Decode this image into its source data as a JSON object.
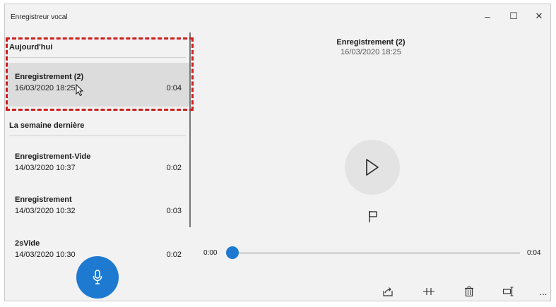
{
  "window": {
    "title": "Enregistreur vocal",
    "controls": {
      "minimize": "–",
      "maximize": "☐",
      "close": "✕"
    }
  },
  "sidebar": {
    "groups": [
      {
        "header": "Aujourd'hui",
        "items": [
          {
            "name": "Enregistrement (2)",
            "date": "16/03/2020 18:25",
            "duration": "0:04",
            "selected": true
          }
        ]
      },
      {
        "header": "La semaine dernière",
        "items": [
          {
            "name": "Enregistrement-Vide",
            "date": "14/03/2020 10:37",
            "duration": "0:02"
          },
          {
            "name": "Enregistrement",
            "date": "14/03/2020 10:32",
            "duration": "0:03"
          },
          {
            "name": "2sVide",
            "date": "14/03/2020 10:30",
            "duration": "0:02"
          }
        ]
      }
    ],
    "record_button": {
      "icon": "microphone-icon"
    }
  },
  "player": {
    "title": "Enregistrement (2)",
    "date": "16/03/2020 18:25",
    "time_start": "0:00",
    "time_end": "0:04",
    "progress": 0.0,
    "play_icon": "play-icon",
    "flag_icon": "flag-icon"
  },
  "toolbar": {
    "items": [
      {
        "id": "share",
        "icon": "share-icon"
      },
      {
        "id": "trim",
        "icon": "trim-icon"
      },
      {
        "id": "delete",
        "icon": "delete-icon"
      },
      {
        "id": "rename",
        "icon": "rename-icon"
      },
      {
        "id": "more",
        "icon": "more-icon",
        "label": "..."
      }
    ]
  },
  "colors": {
    "accent": "#1e7ad0",
    "highlight": "#cc1f1f",
    "selected_bg": "#dcdcdc",
    "panel_bg": "#f2f2f2"
  }
}
